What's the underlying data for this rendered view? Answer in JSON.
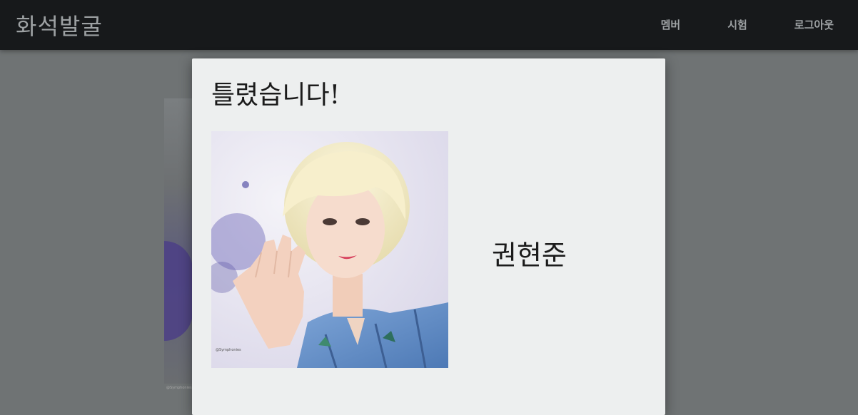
{
  "navbar": {
    "brand": "화석발굴",
    "links": [
      {
        "label": "멤버"
      },
      {
        "label": "시험"
      },
      {
        "label": "로그아웃"
      }
    ]
  },
  "background": {
    "photo_caption": "@Symphonies"
  },
  "modal": {
    "title": "틀렸습니다!",
    "photo_caption": "@Symphonies",
    "answer_name": "권현준"
  },
  "colors": {
    "navbar_bg": "#17191b",
    "overlay": "#6f7374",
    "modal_bg": "#edefef",
    "brand_text": "#9da1a3"
  }
}
